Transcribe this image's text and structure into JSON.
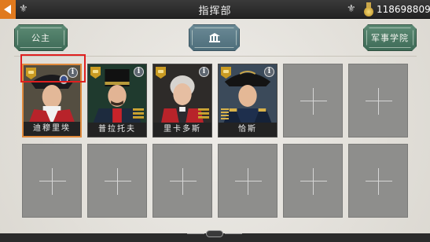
{
  "topbar": {
    "title": "指挥部",
    "coins": "118698809",
    "back_icon": "back-arrow-icon",
    "ornament_icon": "fleur-icon"
  },
  "tabs": {
    "left_label": "公主",
    "center_icon": "building-icon",
    "right_label": "军事学院"
  },
  "generals": [
    {
      "name": "迪穆里埃",
      "selected": true
    },
    {
      "name": "普拉托夫",
      "selected": false
    },
    {
      "name": "里卡多斯",
      "selected": false
    },
    {
      "name": "恰斯",
      "selected": false
    }
  ],
  "empty_slots": 8,
  "colors": {
    "accent_orange": "#e07a1e",
    "tab_green": "#4a7a63",
    "highlight_red": "#e02020"
  }
}
